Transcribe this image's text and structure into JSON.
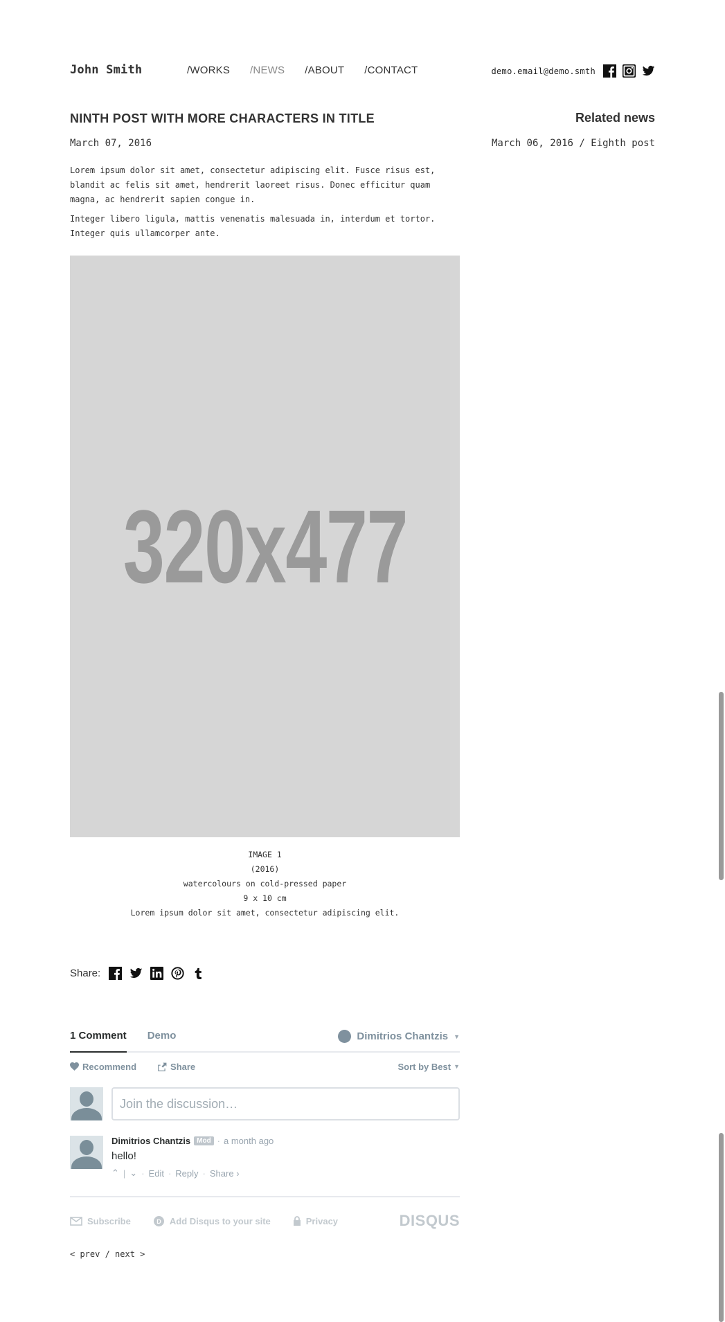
{
  "header": {
    "site_title": "John Smith",
    "nav": [
      {
        "label": "/WORKS",
        "active": false
      },
      {
        "label": "/NEWS",
        "active": true
      },
      {
        "label": "/ABOUT",
        "active": false
      },
      {
        "label": "/CONTACT",
        "active": false
      }
    ],
    "email": "demo.email@demo.smth",
    "social_icons": [
      "facebook-icon",
      "instagram-icon",
      "twitter-icon"
    ]
  },
  "post": {
    "title": "NINTH POST WITH MORE CHARACTERS IN TITLE",
    "date": "March 07, 2016",
    "paragraphs": [
      "Lorem ipsum dolor sit amet, consectetur adipiscing elit. Fusce risus est, blandit ac felis sit amet, hendrerit laoreet risus. Donec efficitur quam magna, ac hendrerit sapien congue in.",
      "Integer libero ligula, mattis venenatis malesuada in, interdum et tortor. Integer quis ullamcorper ante."
    ],
    "image_placeholder": "320x477",
    "caption": {
      "title": "IMAGE 1",
      "year": "(2016)",
      "medium": "watercolours on cold-pressed paper",
      "size": "9 x 10 cm",
      "description": "Lorem ipsum dolor sit amet, consectetur adipiscing elit."
    }
  },
  "related": {
    "title": "Related news",
    "item": "March 06, 2016 / Eighth post"
  },
  "share": {
    "label": "Share:",
    "icons": [
      "facebook-icon",
      "twitter-icon",
      "linkedin-icon",
      "pinterest-icon",
      "tumblr-icon"
    ]
  },
  "disqus": {
    "comment_count": "1 Comment",
    "community": "Demo",
    "user": "Dimitrios Chantzis",
    "recommend": "Recommend",
    "share": "Share",
    "sort": "Sort by Best",
    "placeholder": "Join the discussion…",
    "comment": {
      "author": "Dimitrios Chantzis",
      "badge": "Mod",
      "time": "a month ago",
      "text": "hello!",
      "edit": "Edit",
      "reply": "Reply",
      "share": "Share ›"
    },
    "footer": {
      "subscribe": "Subscribe",
      "add": "Add Disqus to your site",
      "privacy": "Privacy",
      "logo": "DISQUS"
    }
  },
  "pager": {
    "prev": "< prev",
    "sep": " / ",
    "next": "next >"
  },
  "colors": {
    "text": "#333333",
    "nav_active": "#888888",
    "placeholder_bg": "#d6d6d6",
    "placeholder_text": "#9a9a9a",
    "disqus_muted": "#7f919e"
  }
}
